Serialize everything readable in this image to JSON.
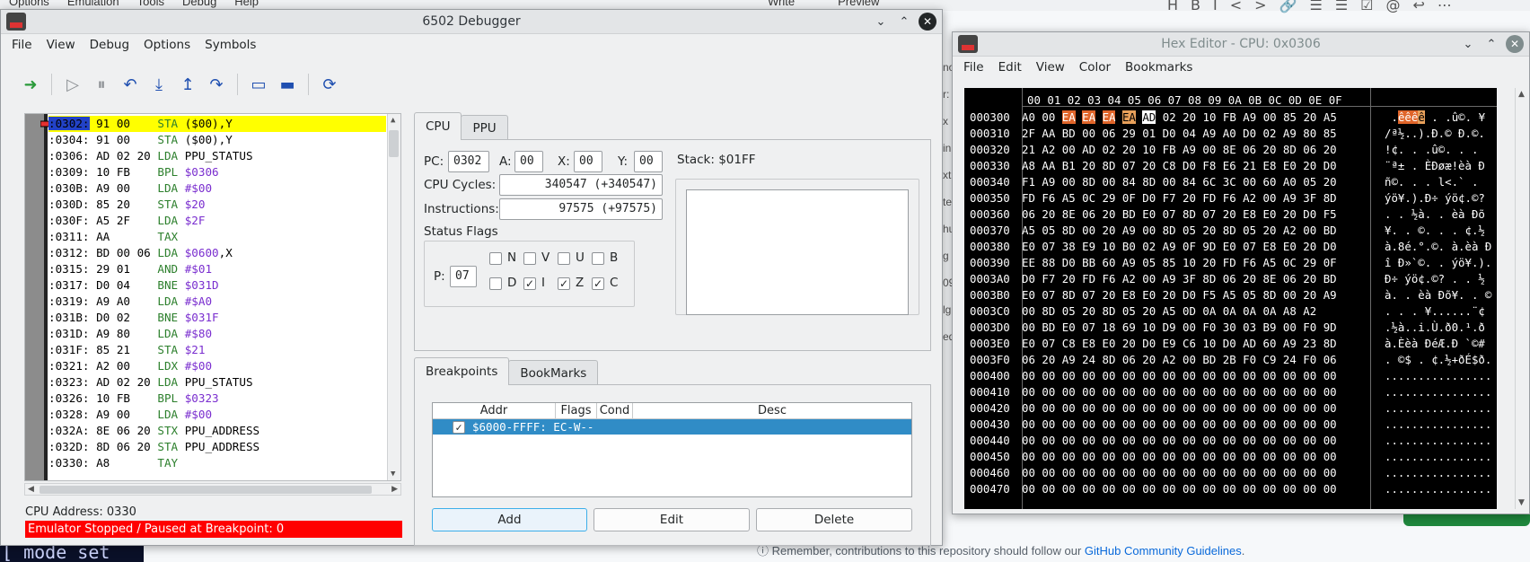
{
  "background": {
    "menu_items": [
      "Options",
      "Emulation",
      "Tools",
      "Debug",
      "Help"
    ],
    "tabs": [
      "Write",
      "Preview"
    ],
    "toolbar_icons": [
      "H",
      "B",
      "I",
      "<>",
      "🔗",
      "☰",
      "☰",
      "☑",
      "@",
      "↩",
      "⋯"
    ],
    "note_prefix": "Remember, contributions to this repository should follow our ",
    "note_link": "GitHub Community Guidelines",
    "note_suffix": ".",
    "side_letters": [
      "no",
      "r:",
      "x",
      "in",
      "xt",
      "tel",
      "hu",
      "g i",
      "096",
      "lg,",
      "ed"
    ],
    "terminal_text": "[ mode set"
  },
  "debugger": {
    "title": "6502 Debugger",
    "menu": [
      "File",
      "View",
      "Debug",
      "Options",
      "Symbols"
    ],
    "toolbar_icons": [
      "run-to-cursor-icon",
      "play-icon",
      "pause-icon",
      "step-back-icon",
      "step-into-icon",
      "step-out-icon",
      "step-over-icon",
      "window-a-icon",
      "window-b-icon",
      "refresh-icon"
    ],
    "disasm": [
      {
        "addr": ":0302:",
        "bytes": "91 00   ",
        "mn": "STA",
        "op": "($00),Y",
        "cur": true
      },
      {
        "addr": ":0304:",
        "bytes": "91 00   ",
        "mn": "STA",
        "op": "($00),Y"
      },
      {
        "addr": ":0306:",
        "bytes": "AD 02 20",
        "mn": "LDA",
        "sym": "PPU_STATUS"
      },
      {
        "addr": ":0309:",
        "bytes": "10 FB   ",
        "mn": "BPL",
        "op": "$0306"
      },
      {
        "addr": ":030B:",
        "bytes": "A9 00   ",
        "mn": "LDA",
        "op": "#$00"
      },
      {
        "addr": ":030D:",
        "bytes": "85 20   ",
        "mn": "STA",
        "op": "$20"
      },
      {
        "addr": ":030F:",
        "bytes": "A5 2F   ",
        "mn": "LDA",
        "op": "$2F"
      },
      {
        "addr": ":0311:",
        "bytes": "AA      ",
        "mn": "TAX"
      },
      {
        "addr": ":0312:",
        "bytes": "BD 00 06",
        "mn": "LDA",
        "op": "$0600",
        "rest": ",X"
      },
      {
        "addr": ":0315:",
        "bytes": "29 01   ",
        "mn": "AND",
        "op": "#$01"
      },
      {
        "addr": ":0317:",
        "bytes": "D0 04   ",
        "mn": "BNE",
        "op": "$031D"
      },
      {
        "addr": ":0319:",
        "bytes": "A9 A0   ",
        "mn": "LDA",
        "op": "#$A0"
      },
      {
        "addr": ":031B:",
        "bytes": "D0 02   ",
        "mn": "BNE",
        "op": "$031F"
      },
      {
        "addr": ":031D:",
        "bytes": "A9 80   ",
        "mn": "LDA",
        "op": "#$80"
      },
      {
        "addr": ":031F:",
        "bytes": "85 21   ",
        "mn": "STA",
        "op": "$21"
      },
      {
        "addr": ":0321:",
        "bytes": "A2 00   ",
        "mn": "LDX",
        "op": "#$00"
      },
      {
        "addr": ":0323:",
        "bytes": "AD 02 20",
        "mn": "LDA",
        "sym": "PPU_STATUS"
      },
      {
        "addr": ":0326:",
        "bytes": "10 FB   ",
        "mn": "BPL",
        "op": "$0323"
      },
      {
        "addr": ":0328:",
        "bytes": "A9 00   ",
        "mn": "LDA",
        "op": "#$00"
      },
      {
        "addr": ":032A:",
        "bytes": "8E 06 20",
        "mn": "STX",
        "sym": "PPU_ADDRESS"
      },
      {
        "addr": ":032D:",
        "bytes": "8D 06 20",
        "mn": "STA",
        "sym": "PPU_ADDRESS"
      },
      {
        "addr": ":0330:",
        "bytes": "A8      ",
        "mn": "TAY"
      }
    ],
    "cpu_address_label": "CPU Address: 0330",
    "status_text": "Emulator Stopped / Paused at Breakpoint: 0",
    "tabs_cpu": [
      "CPU",
      "PPU"
    ],
    "pc_label": "PC:",
    "pc": "0302",
    "a_label": "A:",
    "a": "00",
    "x_label": "X:",
    "x": "00",
    "y_label": "Y:",
    "y": "00",
    "stack_label": "Stack: $01FF",
    "cycles_label": "CPU Cycles:",
    "cycles": "340547  (+340547)",
    "instr_label": "Instructions:",
    "instr": "97575  (+97575)",
    "flags_label": "Status Flags",
    "p_label": "P:",
    "p": "07",
    "flags": [
      {
        "name": "N",
        "checked": false
      },
      {
        "name": "V",
        "checked": false
      },
      {
        "name": "U",
        "checked": false
      },
      {
        "name": "B",
        "checked": false
      },
      {
        "name": "D",
        "checked": false
      },
      {
        "name": "I",
        "checked": true
      },
      {
        "name": "Z",
        "checked": true
      },
      {
        "name": "C",
        "checked": true
      }
    ],
    "check_mark": "✓",
    "tabs_bp": [
      "Breakpoints",
      "BookMarks"
    ],
    "bp_columns": [
      "Addr",
      "Flags",
      "Cond",
      "Desc"
    ],
    "bp_row": "$6000-FFFF: EC-W--",
    "btn_add": "Add",
    "btn_edit": "Edit",
    "btn_delete": "Delete"
  },
  "hex": {
    "title": "Hex Editor - CPU: 0x0306",
    "menu": [
      "File",
      "Edit",
      "View",
      "Color",
      "Bookmarks"
    ],
    "header": "00 01 02 03 04 05 06 07 08 09 0A 0B 0C 0D 0E 0F",
    "rows": [
      {
        "a": "000300",
        "b": "A0 00 EA EA EA EA AD 02 20 10 FB A9 00 85 20 A5",
        "c": " .êêêê ­. .û©. ¥"
      },
      {
        "a": "000310",
        "b": "2F AA BD 00 06 29 01 D0 04 A9 A0 D0 02 A9 80 85",
        "c": "/ª½..).Ð.© Ð.©."
      },
      {
        "a": "000320",
        "b": "21 A2 00 AD 02 20 10 FB A9 00 8E 06 20 8D 06 20",
        "c": "!¢. ­. .û©. . . "
      },
      {
        "a": "000330",
        "b": "A8 AA B1 20 8D 07 20 C8 D0 F8 E6 21 E8 E0 20 D0",
        "c": "¨ª± . ÈÐøæ!èà Ð"
      },
      {
        "a": "000340",
        "b": "F1 A9 00 8D 00 84 8D 00 84 6C 3C 00 60 A0 05 20",
        "c": "ñ©. . . l<.` . "
      },
      {
        "a": "000350",
        "b": "FD F6 A5 0C 29 0F D0 F7 20 FD F6 A2 00 A9 3F 8D",
        "c": "ýö¥.).Ð÷ ýö¢.©?"
      },
      {
        "a": "000360",
        "b": "06 20 8E 06 20 BD E0 07 8D 07 20 E8 E0 20 D0 F5",
        "c": ". . ½à. . èà Ðõ"
      },
      {
        "a": "000370",
        "b": "A5 05 8D 00 20 A9 00 8D 05 20 8D 05 20 A2 00 BD",
        "c": "¥. . ©. . . ¢.½"
      },
      {
        "a": "000380",
        "b": "E0 07 38 E9 10 B0 02 A9 0F 9D E0 07 E8 E0 20 D0",
        "c": "à.8é.°.©. à.èà Ð"
      },
      {
        "a": "000390",
        "b": "EE 88 D0 BB 60 A9 05 85 10 20 FD F6 A5 0C 29 0F",
        "c": "î Ð»`©. . ýö¥.)."
      },
      {
        "a": "0003A0",
        "b": "D0 F7 20 FD F6 A2 00 A9 3F 8D 06 20 8E 06 20 BD",
        "c": "Ð÷ ýö¢.©? . . ½"
      },
      {
        "a": "0003B0",
        "b": "E0 07 8D 07 20 E8 E0 20 D0 F5 A5 05 8D 00 20 A9",
        "c": "à. . èà Ðõ¥. . ©"
      },
      {
        "a": "0003C0",
        "b": "00 8D 05 20 8D 05 20 A5 0D 0A 0A 0A 0A A8 A2",
        "c": ". . . ¥......¨¢"
      },
      {
        "a": "0003D0",
        "b": "00 BD E0 07 18 69 10 D9 00 F0 30 03 B9 00 F0 9D",
        "c": ".½à..i.Ù.ð0.¹.ð"
      },
      {
        "a": "0003E0",
        "b": "E0 07 C8 E8 E0 20 D0 E9 C6 10 D0 AD 60 A9 23 8D",
        "c": "à.Èèà ÐéÆ.Ð `©#"
      },
      {
        "a": "0003F0",
        "b": "06 20 A9 24 8D 06 20 A2 00 BD 2B F0 C9 24 F0 06",
        "c": ". ©$ . ¢.½+ðÉ$ð."
      },
      {
        "a": "000400",
        "b": "00 00 00 00 00 00 00 00 00 00 00 00 00 00 00 00",
        "c": "................"
      },
      {
        "a": "000410",
        "b": "00 00 00 00 00 00 00 00 00 00 00 00 00 00 00 00",
        "c": "................"
      },
      {
        "a": "000420",
        "b": "00 00 00 00 00 00 00 00 00 00 00 00 00 00 00 00",
        "c": "................"
      },
      {
        "a": "000430",
        "b": "00 00 00 00 00 00 00 00 00 00 00 00 00 00 00 00",
        "c": "................"
      },
      {
        "a": "000440",
        "b": "00 00 00 00 00 00 00 00 00 00 00 00 00 00 00 00",
        "c": "................"
      },
      {
        "a": "000450",
        "b": "00 00 00 00 00 00 00 00 00 00 00 00 00 00 00 00",
        "c": "................"
      },
      {
        "a": "000460",
        "b": "00 00 00 00 00 00 00 00 00 00 00 00 00 00 00 00",
        "c": "................"
      },
      {
        "a": "000470",
        "b": "00 00 00 00 00 00 00 00 00 00 00 00 00 00 00 00",
        "c": "................"
      }
    ]
  }
}
